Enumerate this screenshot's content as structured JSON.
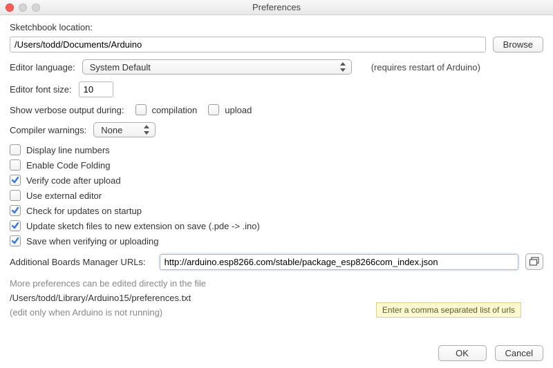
{
  "window": {
    "title": "Preferences"
  },
  "sketchbook": {
    "label": "Sketchbook location:",
    "value": "/Users/todd/Documents/Arduino",
    "browse": "Browse"
  },
  "editor_language": {
    "label": "Editor language:",
    "selected": "System Default",
    "hint": "(requires restart of Arduino)"
  },
  "font_size": {
    "label": "Editor font size:",
    "value": "10"
  },
  "verbose": {
    "label": "Show verbose output during:",
    "compilation_label": "compilation",
    "upload_label": "upload",
    "compilation_checked": false,
    "upload_checked": false
  },
  "compiler_warnings": {
    "label": "Compiler warnings:",
    "selected": "None"
  },
  "options": [
    {
      "label": "Display line numbers",
      "checked": false
    },
    {
      "label": "Enable Code Folding",
      "checked": false
    },
    {
      "label": "Verify code after upload",
      "checked": true
    },
    {
      "label": "Use external editor",
      "checked": false
    },
    {
      "label": "Check for updates on startup",
      "checked": true
    },
    {
      "label": "Update sketch files to new extension on save (.pde -> .ino)",
      "checked": true
    },
    {
      "label": "Save when verifying or uploading",
      "checked": true
    }
  ],
  "boards_urls": {
    "label": "Additional Boards Manager URLs:",
    "value": "http://arduino.esp8266.com/stable/package_esp8266com_index.json",
    "tooltip": "Enter a comma separated list of urls"
  },
  "more": {
    "line1": "More preferences can be edited directly in the file",
    "path": "/Users/todd/Library/Arduino15/preferences.txt",
    "line2": "(edit only when Arduino is not running)"
  },
  "footer": {
    "ok": "OK",
    "cancel": "Cancel"
  }
}
